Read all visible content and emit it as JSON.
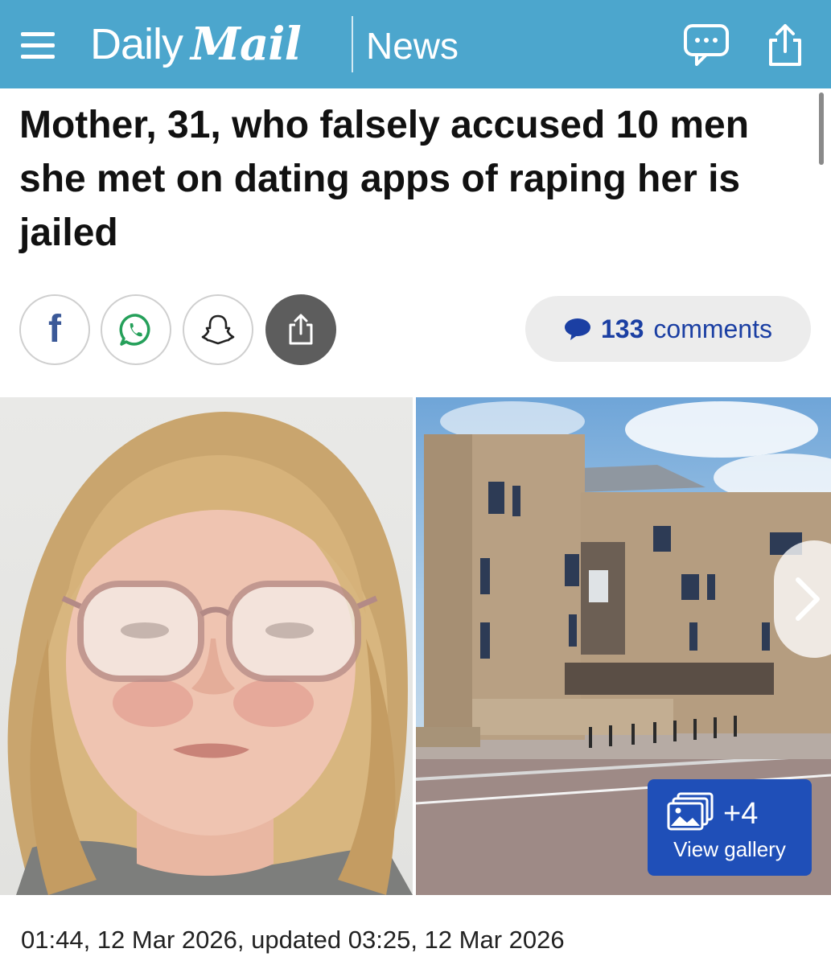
{
  "header": {
    "brand_daily": "Daily",
    "brand_mail": "Mail",
    "section": "News",
    "bg_color": "#4ca6cd",
    "icons": [
      "menu-icon",
      "comment-bubble-icon",
      "share-icon"
    ]
  },
  "article": {
    "headline": "Mother, 31, who falsely accused 10 men she met on dating apps of raping her is jailed",
    "timestamp": "01:44, 12 Mar 2026, updated 03:25, 12 Mar 2026"
  },
  "share": {
    "buttons": [
      "facebook-icon",
      "whatsapp-icon",
      "snapchat-icon",
      "share-icon"
    ],
    "facebook_glyph": "f",
    "comments_count": "133",
    "comments_label": "comments",
    "accent_color": "#1b3fa3"
  },
  "gallery": {
    "count_label": "+4",
    "view_label": "View gallery",
    "button_color": "#1f4fb8"
  }
}
